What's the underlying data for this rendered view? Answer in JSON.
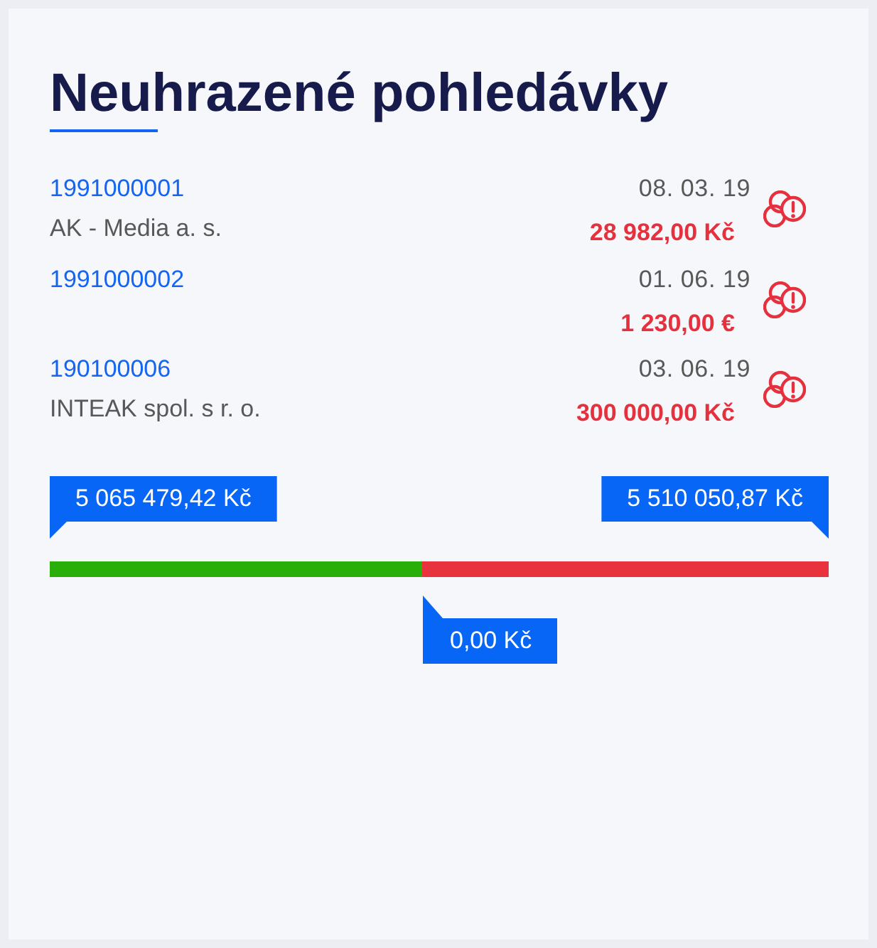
{
  "title": "Neuhrazené pohledávky",
  "invoices": [
    {
      "number": "1991000001",
      "date": "08. 03. 19",
      "customer": "AK - Media a. s.",
      "amount": "28 982,00 Kč"
    },
    {
      "number": "1991000002",
      "date": "01. 06. 19",
      "amount": "1 230,00 €"
    },
    {
      "number": "190100006",
      "date": "03. 06. 19",
      "customer": "INTEAK spol. s r. o.",
      "amount": "300 000,00 Kč"
    }
  ],
  "balance": {
    "level": 0.479,
    "left_flag": "5 065 479,42 Kč",
    "right_flag": "5 510 050,87 Kč",
    "marker": "0,00 Kč"
  }
}
